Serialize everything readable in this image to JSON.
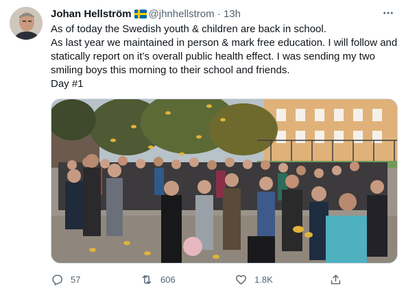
{
  "tweet": {
    "author": {
      "name": "Johan Hellström",
      "handle": "@jhnhellstrom",
      "flag_icon": "swedish-flag-icon",
      "avatar_icon": "avatar-photo"
    },
    "separator": "·",
    "time": "13h",
    "more_icon": "more-horizontal-icon",
    "text": "As of today the Swedish youth & children are back in school.\nAs last year we maintained in person & mark free education. I will follow and statically report on it’s overall public health effect. I was sending my two smiling boys this morning to their school and friends.\nDay #1",
    "media": {
      "type": "photo",
      "subject_icon": "schoolyard-photo"
    },
    "actions": {
      "reply": {
        "icon": "reply-icon",
        "count": "57"
      },
      "retweet": {
        "icon": "retweet-icon",
        "count": "606"
      },
      "like": {
        "icon": "heart-icon",
        "count": "1.8K"
      },
      "share": {
        "icon": "share-icon"
      }
    }
  },
  "colors": {
    "text_primary": "#0f1419",
    "text_secondary": "#536471",
    "border": "#cfd9de",
    "background": "#ffffff"
  }
}
